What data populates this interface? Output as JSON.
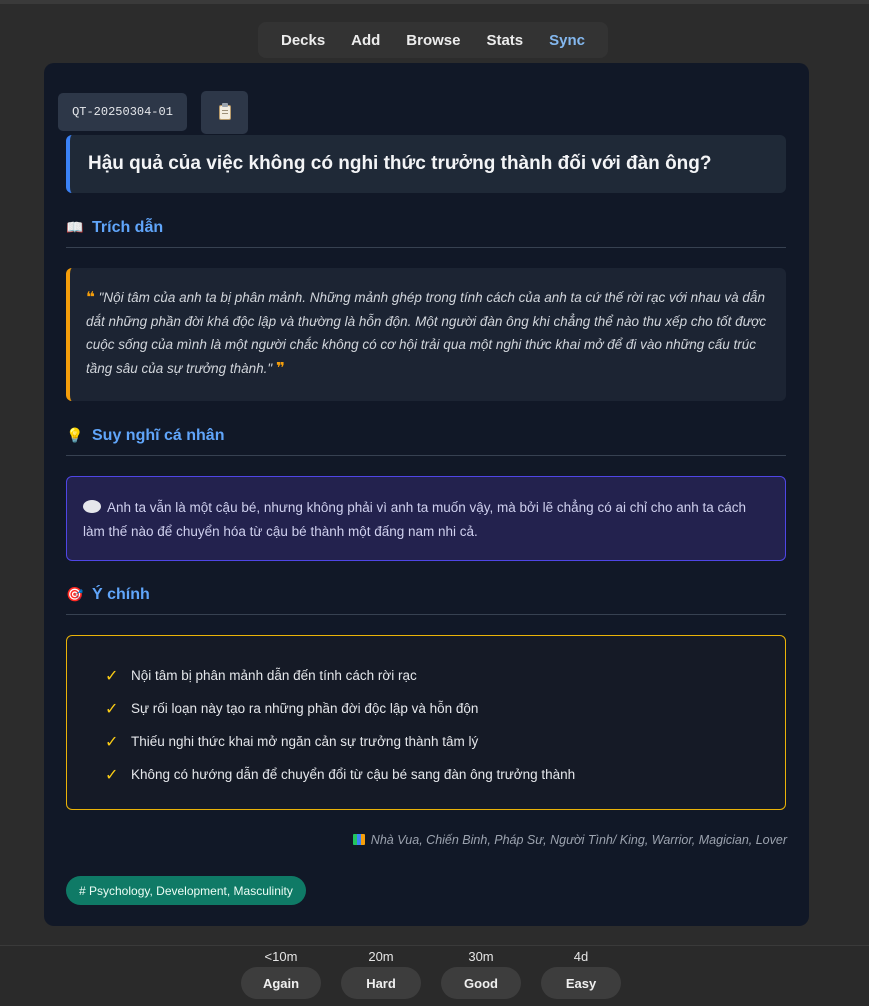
{
  "nav": {
    "decks": "Decks",
    "add": "Add",
    "browse": "Browse",
    "stats": "Stats",
    "sync": "Sync"
  },
  "card": {
    "id": "QT-20250304-01",
    "question": "Hậu quả của việc không có nghi thức trưởng thành đối với đàn ông?",
    "quote_section": {
      "title": "Trích dẫn",
      "icon": "open-book-icon"
    },
    "quote_open": "❝",
    "quote_text": "\"Nội tâm của anh ta bị phân mảnh. Những mảnh ghép trong tính cách của anh ta cứ thế rời rạc với nhau và dẫn dắt những phần đời khá độc lập và thường là hỗn độn. Một người đàn ông khi chẳng thể nào thu xếp cho tốt được cuộc sống của mình là một người chắc không có cơ hội trải qua một nghi thức khai mở để đi vào những cấu trúc tầng sâu của sự trưởng thành.\"",
    "quote_close": "❞",
    "thought_section": {
      "title": "Suy nghĩ cá nhân",
      "icon": "light-bulb-icon"
    },
    "thought_text": "Anh ta vẫn là một cậu bé, nhưng không phải vì anh ta muốn vậy, mà bởi lẽ chẳng có ai chỉ cho anh ta cách làm thế nào để chuyển hóa từ cậu bé thành một đấng nam nhi cả.",
    "points_section": {
      "title": "Ý chính",
      "icon": "target-icon"
    },
    "points": [
      "Nội tâm bị phân mảnh dẫn đến tính cách rời rạc",
      "Sự rối loạn này tạo ra những phần đời độc lập và hỗn độn",
      "Thiếu nghi thức khai mở ngăn cản sự trưởng thành tâm lý",
      "Không có hướng dẫn để chuyển đổi từ cậu bé sang đàn ông trưởng thành"
    ],
    "source": "Nhà Vua, Chiến Binh, Pháp Sư, Người Tình/ King, Warrior, Magician, Lover",
    "tag": "# Psychology, Development, Masculinity"
  },
  "answer_buttons": [
    {
      "time": "<10m",
      "label": "Again"
    },
    {
      "time": "20m",
      "label": "Hard"
    },
    {
      "time": "30m",
      "label": "Good"
    },
    {
      "time": "4d",
      "label": "Easy"
    }
  ],
  "colors": {
    "accent_blue": "#3b82f6",
    "quote_orange": "#f59e0b",
    "thought_indigo": "#4f46e5",
    "points_yellow": "#eab308",
    "tag_green": "#0f7a66"
  }
}
